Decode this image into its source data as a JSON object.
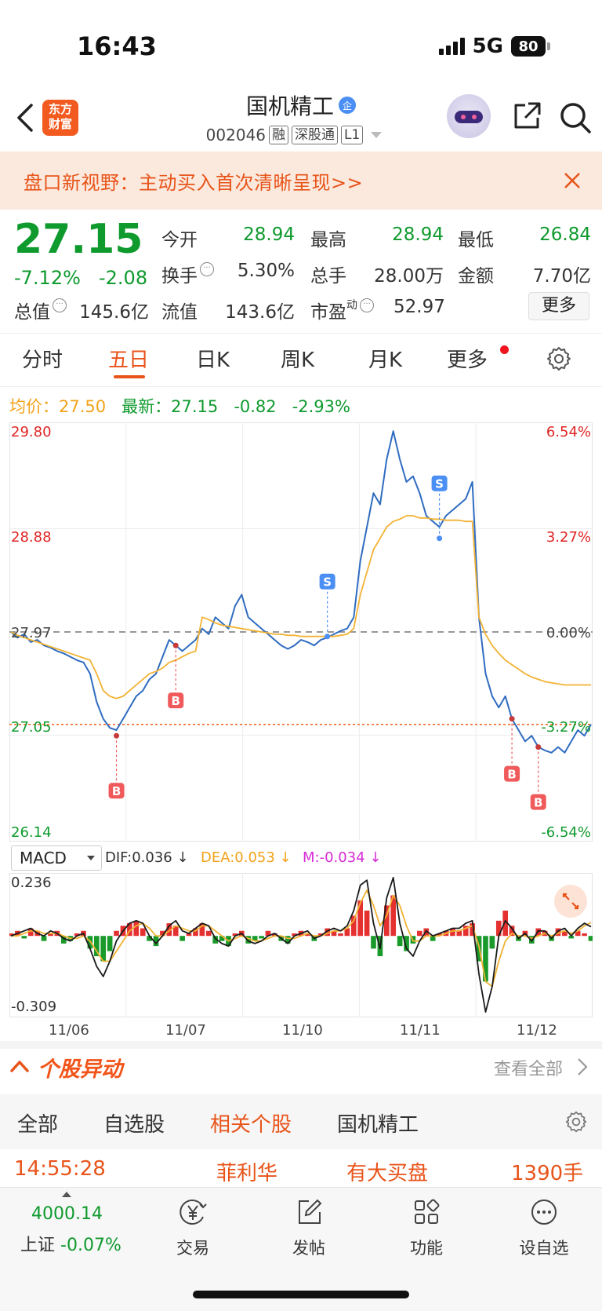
{
  "status_bar": {
    "time": "16:43",
    "network": "5G",
    "battery": "80"
  },
  "header": {
    "logo_text": "东方财富",
    "title": "国机精工",
    "title_badge": "企",
    "code": "002046",
    "tags": [
      "融",
      "深股通",
      "L1"
    ]
  },
  "banner": {
    "text": "盘口新视野：主动买入首次清晰呈现>>"
  },
  "quote": {
    "price": "27.15",
    "change_pct": "-7.12%",
    "change_amt": "-2.08",
    "open_label": "今开",
    "open": "28.94",
    "high_label": "最高",
    "high": "28.94",
    "low_label": "最低",
    "low": "26.84",
    "turnover_label": "换手",
    "turnover": "5.30%",
    "volume_label": "总手",
    "volume": "28.00万",
    "amount_label": "金额",
    "amount": "7.70亿",
    "total_mv_label": "总值",
    "total_mv": "145.6亿",
    "float_mv_label": "流值",
    "float_mv": "143.6亿",
    "pe_label": "市盈",
    "pe_sup": "动",
    "pe": "52.97",
    "more": "更多"
  },
  "tabs": [
    "分时",
    "五日",
    "日K",
    "周K",
    "月K",
    "更多"
  ],
  "active_tab": "五日",
  "summary": {
    "avg_label": "均价：",
    "avg": "27.50",
    "latest_label": "最新：",
    "latest": "27.15",
    "latest_chg": "-0.82",
    "latest_pct": "-2.93%"
  },
  "chart_data": {
    "type": "line",
    "title": "",
    "xlabel": "",
    "ylabel": "",
    "dates": [
      "11/06",
      "11/07",
      "11/10",
      "11/11",
      "11/12"
    ],
    "y_labels_left": [
      "29.80",
      "28.88",
      "27.97",
      "27.05",
      "26.14"
    ],
    "y_labels_right": [
      "6.54%",
      "3.27%",
      "0.00%",
      "-3.27%",
      "-6.54%"
    ],
    "ylim": [
      26.14,
      29.8
    ],
    "prev_close": 27.97,
    "reference_price": 27.15,
    "series": [
      {
        "color": "#2f6cc0",
        "values": [
          27.97,
          27.92,
          27.95,
          27.88,
          27.9,
          27.85,
          27.83,
          27.8,
          27.78,
          27.75,
          27.72,
          27.7,
          27.6,
          27.35,
          27.2,
          27.12,
          27.1,
          27.2,
          27.3,
          27.4,
          27.45,
          27.55,
          27.6,
          27.75,
          27.9,
          27.85,
          27.8,
          27.85,
          27.9,
          28.0,
          27.95,
          28.1,
          28.05,
          28.0,
          28.2,
          28.3,
          28.1,
          28.05,
          28.0,
          27.95,
          27.9,
          27.85,
          27.82,
          27.85,
          27.9,
          27.88,
          27.85,
          27.9,
          27.92,
          27.95,
          27.98,
          28.0,
          28.1,
          28.6,
          28.9,
          29.2,
          29.1,
          29.5,
          29.75,
          29.5,
          29.3,
          29.35,
          29.2,
          29.0,
          28.95,
          28.9,
          29.0,
          29.05,
          29.1,
          29.15,
          29.3,
          28.1,
          27.6,
          27.4,
          27.3,
          27.4,
          27.2,
          27.1,
          27.0,
          27.05,
          26.95,
          26.92,
          26.9,
          26.95,
          26.9,
          27.0,
          27.1,
          27.05,
          27.15
        ]
      },
      {
        "color": "#f2b233",
        "values": [
          27.97,
          27.94,
          27.92,
          27.9,
          27.88,
          27.86,
          27.84,
          27.82,
          27.8,
          27.78,
          27.76,
          27.74,
          27.72,
          27.6,
          27.45,
          27.4,
          27.38,
          27.4,
          27.45,
          27.5,
          27.55,
          27.6,
          27.62,
          27.65,
          27.7,
          27.72,
          27.75,
          27.78,
          27.8,
          28.1,
          28.08,
          28.05,
          28.03,
          28.02,
          28.01,
          28.0,
          27.99,
          27.98,
          27.97,
          27.96,
          27.95,
          27.95,
          27.94,
          27.94,
          27.93,
          27.93,
          27.93,
          27.93,
          27.93,
          27.93,
          27.94,
          27.95,
          28.0,
          28.3,
          28.5,
          28.7,
          28.8,
          28.9,
          28.95,
          28.97,
          29.0,
          29.0,
          28.98,
          28.98,
          28.97,
          28.97,
          28.96,
          28.96,
          28.96,
          28.95,
          28.95,
          28.1,
          27.95,
          27.85,
          27.78,
          27.72,
          27.68,
          27.64,
          27.6,
          27.57,
          27.55,
          27.53,
          27.52,
          27.51,
          27.5,
          27.5,
          27.5,
          27.5,
          27.5
        ]
      }
    ],
    "markers": [
      {
        "type": "B",
        "price": 27.05
      },
      {
        "type": "B",
        "price": 27.85
      },
      {
        "type": "S",
        "price": 27.93
      },
      {
        "type": "S",
        "price": 28.8
      },
      {
        "type": "B",
        "price": 27.2
      },
      {
        "type": "B",
        "price": 26.95
      }
    ]
  },
  "macd": {
    "selector": "MACD",
    "dif_label": "DIF:0.036 ↓",
    "dea_label": "DEA:0.053 ↓",
    "m_label": "M:-0.034 ↓",
    "y_max": "0.236",
    "y_min": "-0.309",
    "ylim": [
      -0.309,
      0.236
    ],
    "histogram": [
      0.01,
      0.02,
      -0.01,
      0.03,
      0.02,
      -0.02,
      0.01,
      0.02,
      -0.03,
      -0.02,
      0.01,
      0.02,
      -0.05,
      -0.08,
      -0.1,
      -0.06,
      0.02,
      0.04,
      0.05,
      0.06,
      0.03,
      -0.02,
      -0.04,
      0.02,
      0.05,
      0.04,
      -0.02,
      0.01,
      0.03,
      0.05,
      0.02,
      -0.03,
      -0.02,
      -0.04,
      0.01,
      0.02,
      -0.03,
      -0.02,
      -0.01,
      0.02,
      0.01,
      -0.02,
      -0.03,
      0.01,
      0.02,
      0.01,
      -0.02,
      0.01,
      0.03,
      0.02,
      0.01,
      0.03,
      0.08,
      0.14,
      0.1,
      -0.05,
      -0.08,
      0.12,
      0.16,
      -0.04,
      -0.06,
      -0.03,
      0.02,
      0.03,
      -0.02,
      0.01,
      0.02,
      0.03,
      0.02,
      0.04,
      0.05,
      -0.1,
      -0.18,
      -0.05,
      0.06,
      0.1,
      0.04,
      -0.02,
      0.02,
      -0.03,
      0.03,
      0.02,
      -0.02,
      0.03,
      0.02,
      -0.01,
      0.02,
      0.01,
      -0.02
    ],
    "dif": [
      0.0,
      0.01,
      0.02,
      0.03,
      0.01,
      0.0,
      0.02,
      0.01,
      -0.01,
      -0.02,
      0.0,
      0.01,
      -0.05,
      -0.12,
      -0.16,
      -0.1,
      -0.02,
      0.02,
      0.05,
      0.06,
      0.05,
      0.0,
      -0.03,
      0.0,
      0.04,
      0.06,
      0.02,
      0.01,
      0.03,
      0.05,
      0.04,
      -0.01,
      -0.03,
      -0.04,
      0.0,
      0.01,
      -0.02,
      -0.03,
      -0.02,
      0.0,
      0.01,
      -0.01,
      -0.03,
      0.0,
      0.01,
      0.02,
      -0.01,
      0.0,
      0.02,
      0.03,
      0.02,
      0.04,
      0.1,
      0.2,
      0.22,
      0.05,
      -0.05,
      0.15,
      0.23,
      0.05,
      -0.05,
      -0.08,
      -0.02,
      0.02,
      0.0,
      0.01,
      0.02,
      0.03,
      0.03,
      0.05,
      0.06,
      -0.15,
      -0.3,
      -0.2,
      0.0,
      0.06,
      0.03,
      -0.01,
      0.01,
      -0.02,
      0.02,
      0.02,
      -0.01,
      0.02,
      0.03,
      0.0,
      0.03,
      0.05,
      0.036
    ],
    "dea": [
      0.0,
      0.0,
      0.01,
      0.02,
      0.02,
      0.01,
      0.01,
      0.01,
      0.0,
      -0.01,
      -0.01,
      0.0,
      -0.02,
      -0.06,
      -0.1,
      -0.1,
      -0.06,
      -0.02,
      0.02,
      0.04,
      0.05,
      0.03,
      0.0,
      0.0,
      0.02,
      0.04,
      0.03,
      0.02,
      0.02,
      0.04,
      0.04,
      0.02,
      0.0,
      -0.02,
      -0.01,
      0.0,
      -0.01,
      -0.02,
      -0.02,
      -0.01,
      0.0,
      0.0,
      -0.01,
      -0.01,
      0.0,
      0.01,
      0.0,
      0.0,
      0.01,
      0.02,
      0.02,
      0.03,
      0.06,
      0.13,
      0.18,
      0.12,
      0.04,
      0.08,
      0.16,
      0.12,
      0.04,
      -0.02,
      -0.02,
      0.0,
      0.0,
      0.0,
      0.01,
      0.02,
      0.02,
      0.03,
      0.04,
      -0.04,
      -0.18,
      -0.2,
      -0.1,
      -0.02,
      0.01,
      0.0,
      0.0,
      -0.01,
      0.0,
      0.01,
      0.0,
      0.01,
      0.02,
      0.01,
      0.02,
      0.04,
      0.053
    ]
  },
  "section": {
    "title": "个股异动",
    "view_all": "查看全部"
  },
  "subtabs": [
    "全部",
    "自选股",
    "相关个股",
    "国机精工"
  ],
  "active_subtab": "相关个股",
  "news": {
    "time": "14:55:28",
    "stock": "菲利华",
    "event": "有大买盘",
    "volume": "1390手"
  },
  "bottom_nav": {
    "index_value": "4000.14",
    "index_name": "上证",
    "index_change": "-0.07%",
    "items": [
      {
        "label": "交易",
        "icon": "yen-exchange-icon"
      },
      {
        "label": "发帖",
        "icon": "edit-post-icon"
      },
      {
        "label": "功能",
        "icon": "grid-apps-icon"
      },
      {
        "label": "设自选",
        "icon": "more-dots-icon"
      }
    ]
  },
  "colors": {
    "accent": "#e8541a",
    "down": "#0f9a2e",
    "up": "#e02424",
    "price_line": "#2f6cc0",
    "avg_line": "#f2b233"
  }
}
